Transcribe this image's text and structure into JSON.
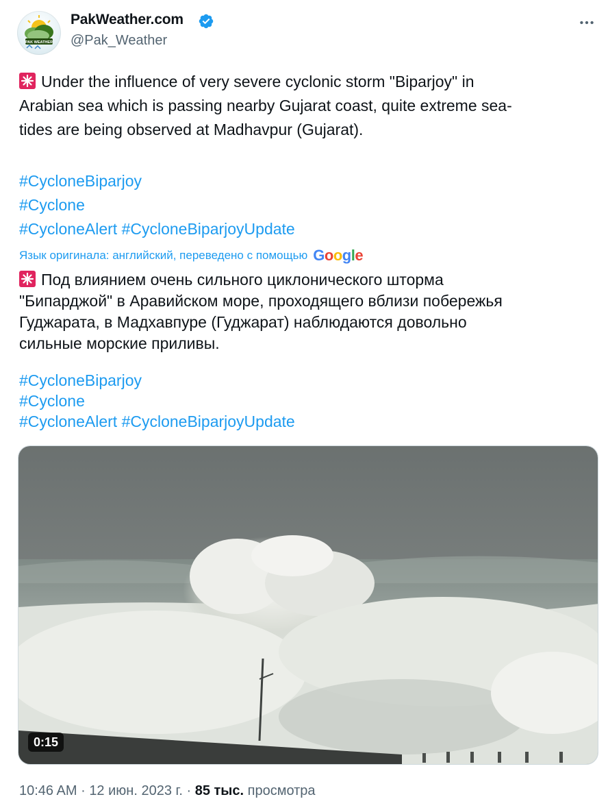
{
  "author": {
    "display_name": "PakWeather.com",
    "handle": "@Pak_Weather",
    "avatar_logo_text": "PAK WEATHER"
  },
  "post": {
    "original_lines": [
      "Under the influence of very severe cyclonic storm \"Biparjoy\" in",
      "Arabian sea which is passing nearby Gujarat coast, quite extreme sea-",
      "tides are being observed at Madhavpur (Gujarat)."
    ],
    "original_hashtags": [
      "#CycloneBiparjoy",
      "#Cyclone",
      "#CycloneAlert",
      "#CycloneBiparjoyUpdate"
    ],
    "translation_notice": "Язык оригинала: английский, переведено с помощью",
    "translation_provider": "Google",
    "translated_lines": [
      "Под влиянием очень сильного циклонического шторма",
      "\"Бипарджой\" в Аравийском море, проходящего вблизи побережья",
      "Гуджарата, в Мадхавпуре (Гуджарат) наблюдаются довольно",
      "сильные морские приливы."
    ],
    "translated_hashtags": [
      "#CycloneBiparjoy",
      "#Cyclone",
      "#CycloneAlert",
      "#CycloneBiparjoyUpdate"
    ]
  },
  "media": {
    "type": "video",
    "duration": "0:15"
  },
  "meta": {
    "time": "10:46 AM",
    "separator": "·",
    "date": "12 июн. 2023 г.",
    "views_count": "85 тыс.",
    "views_label": "просмотра"
  },
  "icons": {
    "emoji": "siren-icon",
    "verified": "verified-badge-icon",
    "more": "more-icon"
  },
  "colors": {
    "link": "#1d9bf0",
    "text": "#0f1419",
    "secondary": "#536471",
    "verified": "#1d9bf0",
    "siren": "#e0245e"
  }
}
